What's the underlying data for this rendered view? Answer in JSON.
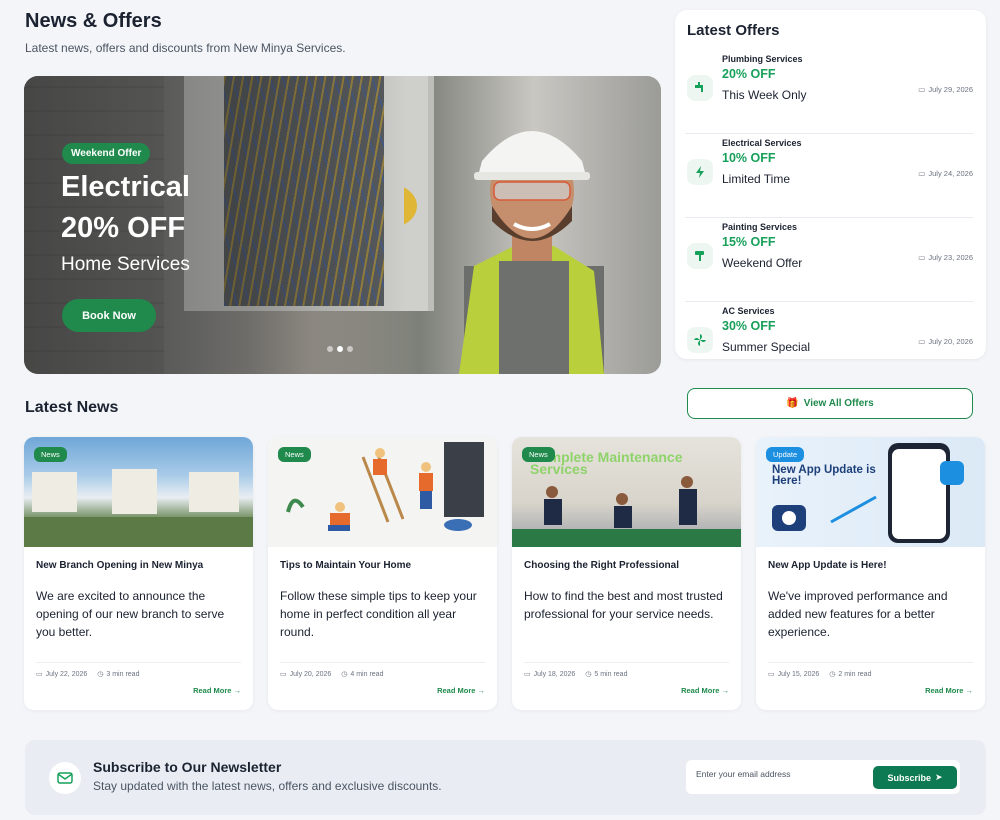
{
  "header": {
    "title": "News & Offers",
    "subtitle": "Latest news, offers and discounts from New Minya Services."
  },
  "hero": {
    "badge": "Weekend Offer",
    "title": "Electrical",
    "discount": "20% OFF",
    "subtitle": "Home Services",
    "button": "Book Now",
    "slides": 3,
    "active_slide": 2
  },
  "offers": {
    "title": "Latest Offers",
    "items": [
      {
        "category": "Plumbing Services",
        "discount": "20% OFF",
        "name": "This Week Only",
        "date": "July 29, 2026",
        "icon": "faucet-icon"
      },
      {
        "category": "Electrical Services",
        "discount": "10% OFF",
        "name": "Limited Time",
        "date": "July 24, 2026",
        "icon": "lightning-icon"
      },
      {
        "category": "Painting Services",
        "discount": "15% OFF",
        "name": "Weekend Offer",
        "date": "July 23, 2026",
        "icon": "paint-roller-icon"
      },
      {
        "category": "AC Services",
        "discount": "30% OFF",
        "name": "Summer Special",
        "date": "July 20, 2026",
        "icon": "fan-icon"
      }
    ],
    "view_all": "View All Offers"
  },
  "news": {
    "heading": "Latest News",
    "cards": [
      {
        "tag": "News",
        "title": "New Branch Opening in New Minya",
        "text": "We are excited to announce the opening of our new branch to serve you better.",
        "date": "July 22, 2026",
        "read_time": "3 min read",
        "link": "Read More"
      },
      {
        "tag": "News",
        "title": "Tips to Maintain Your Home",
        "text": "Follow these simple tips to keep your home in perfect condition all year round.",
        "date": "July 20, 2026",
        "read_time": "4 min read",
        "link": "Read More"
      },
      {
        "tag": "News",
        "title": "Choosing the Right Professional",
        "text": "How to find the best and most trusted professional for your service needs.",
        "date": "July 18, 2026",
        "read_time": "5 min read",
        "link": "Read More"
      },
      {
        "tag": "Update",
        "title": "New App Update is Here!",
        "text": "We've improved performance and added new features for a better experience.",
        "date": "July 15, 2026",
        "read_time": "2 min read",
        "link": "Read More"
      }
    ],
    "image_texts": {
      "card3_banner": "Complete Maintenance Services",
      "card4_banner": "New App Update is Here!"
    }
  },
  "newsletter": {
    "title": "Subscribe to Our Newsletter",
    "subtitle": "Stay updated with the latest news, offers and exclusive discounts.",
    "placeholder": "Enter your email address",
    "button": "Subscribe"
  },
  "colors": {
    "accent": "#1f8a4c",
    "offer_green": "#17a05a",
    "update_blue": "#1d8fe0",
    "subscribe_button": "#0e7a53"
  }
}
